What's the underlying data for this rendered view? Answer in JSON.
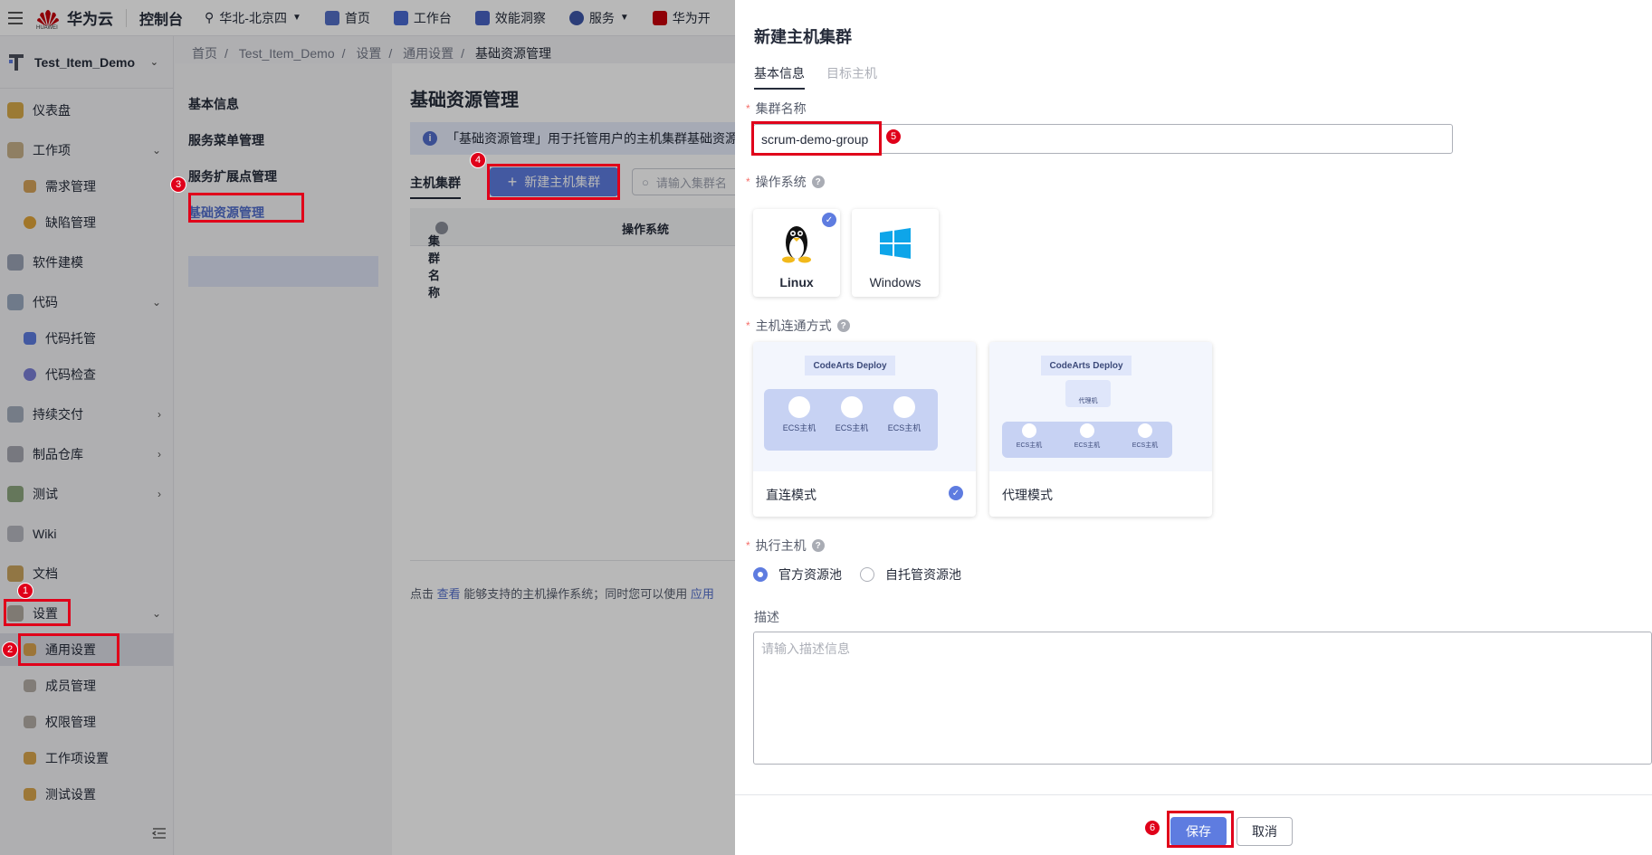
{
  "topbar": {
    "brand": "华为云",
    "brand_sub": "HUAWEI",
    "console": "控制台",
    "region": "华北-北京四",
    "items": [
      "首页",
      "工作台",
      "效能洞察",
      "服务",
      "华为开"
    ]
  },
  "project": {
    "name": "Test_Item_Demo"
  },
  "sidebar": {
    "items": [
      {
        "label": "仪表盘"
      },
      {
        "label": "工作项"
      },
      {
        "label": "需求管理"
      },
      {
        "label": "缺陷管理"
      },
      {
        "label": "软件建模"
      },
      {
        "label": "代码"
      },
      {
        "label": "代码托管"
      },
      {
        "label": "代码检查"
      },
      {
        "label": "持续交付"
      },
      {
        "label": "制品仓库"
      },
      {
        "label": "测试"
      },
      {
        "label": "Wiki"
      },
      {
        "label": "文档"
      },
      {
        "label": "设置"
      },
      {
        "label": "通用设置"
      },
      {
        "label": "成员管理"
      },
      {
        "label": "权限管理"
      },
      {
        "label": "工作项设置"
      },
      {
        "label": "测试设置"
      }
    ]
  },
  "breadcrumb": [
    "首页",
    "Test_Item_Demo",
    "设置",
    "通用设置",
    "基础资源管理"
  ],
  "settings_menu": [
    "基本信息",
    "服务菜单管理",
    "服务扩展点管理",
    "基础资源管理"
  ],
  "main": {
    "title": "基础资源管理",
    "info": "「基础资源管理」用于托管用户的主机集群基础资源",
    "tab": "主机集群",
    "new_button": "新建主机集群",
    "search_placeholder": "请输入集群名",
    "col_name": "集群名称",
    "col_os": "操作系统",
    "hint_prefix": "点击",
    "hint_link": "查看",
    "hint_mid": "能够支持的主机操作系统；同时您可以使用",
    "hint_link2": "应用"
  },
  "drawer": {
    "title": "新建主机集群",
    "tab_basic": "基本信息",
    "tab_target": "目标主机",
    "label_name": "集群名称",
    "name_value": "scrum-demo-group",
    "label_os": "操作系统",
    "os_linux": "Linux",
    "os_windows": "Windows",
    "label_conn": "主机连通方式",
    "mode_direct": "直连模式",
    "mode_proxy": "代理模式",
    "diagram_title": "CodeArts Deploy",
    "diagram_host": "ECS主机",
    "diagram_proxy": "代理机",
    "label_exec": "执行主机",
    "exec_official": "官方资源池",
    "exec_self": "自托管资源池",
    "label_desc": "描述",
    "desc_placeholder": "请输入描述信息",
    "save": "保存",
    "cancel": "取消"
  },
  "annotations": [
    "1",
    "2",
    "3",
    "4",
    "5",
    "6"
  ],
  "colors": {
    "accent": "#5e7ce0",
    "highlight": "#e0001a",
    "brand": "#c7000b"
  }
}
